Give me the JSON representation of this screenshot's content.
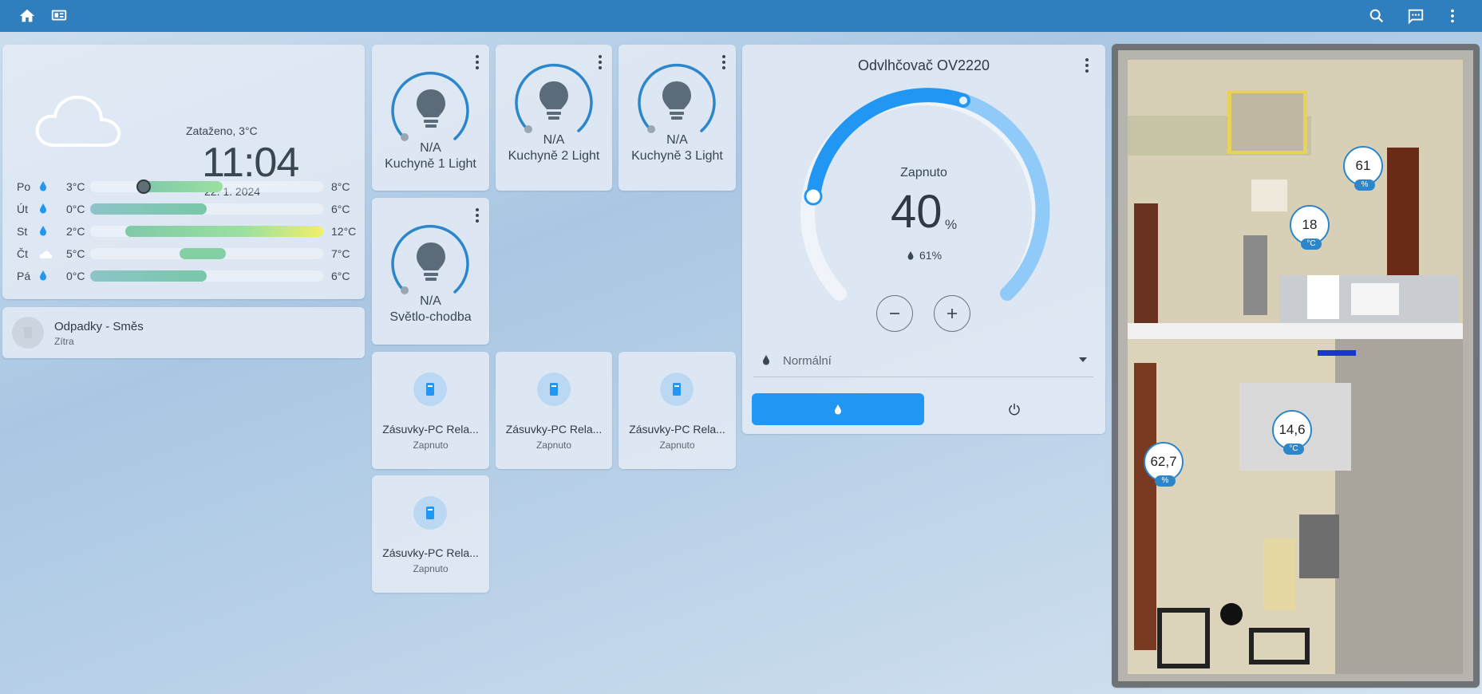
{
  "weather": {
    "condition": "Zataženo, 3°C",
    "time": "11:04",
    "date": "22. 1. 2024",
    "forecast": [
      {
        "day": "Po",
        "icon": "rain-drop-icon",
        "low": "3°C",
        "high": "8°C"
      },
      {
        "day": "Út",
        "icon": "rain-drop-icon",
        "low": "0°C",
        "high": "6°C"
      },
      {
        "day": "St",
        "icon": "rain-drop-icon",
        "low": "2°C",
        "high": "12°C"
      },
      {
        "day": "Čt",
        "icon": "cloud-icon",
        "low": "5°C",
        "high": "7°C"
      },
      {
        "day": "Pá",
        "icon": "rain-drop-icon",
        "low": "0°C",
        "high": "6°C"
      }
    ]
  },
  "waste": {
    "title": "Odpadky - Směs",
    "subtitle": "Zítra"
  },
  "lights": [
    {
      "state": "N/A",
      "name": "Kuchyně 1 Light"
    },
    {
      "state": "N/A",
      "name": "Kuchyně 2 Light"
    },
    {
      "state": "N/A",
      "name": "Kuchyně 3 Light"
    },
    {
      "state": "N/A",
      "name": "Světlo-chodba"
    }
  ],
  "switches": [
    {
      "name": "Zásuvky-PC Rela...",
      "state": "Zapnuto"
    },
    {
      "name": "Zásuvky-PC Rela...",
      "state": "Zapnuto"
    },
    {
      "name": "Zásuvky-PC Rela...",
      "state": "Zapnuto"
    },
    {
      "name": "Zásuvky-PC Rela...",
      "state": "Zapnuto"
    }
  ],
  "dehumidifier": {
    "title": "Odvlhčovač OV2220",
    "state": "Zapnuto",
    "target": "40",
    "target_unit": "%",
    "current_humidity": "61%",
    "mode": "Normální"
  },
  "floorplan": {
    "sensors": [
      {
        "value": "61",
        "unit": "%"
      },
      {
        "value": "18",
        "unit": "°C"
      },
      {
        "value": "14,6",
        "unit": "°C"
      },
      {
        "value": "62,7",
        "unit": "%"
      }
    ]
  },
  "colors": {
    "accent": "#2196f3",
    "topbar": "#2f7fbf"
  }
}
